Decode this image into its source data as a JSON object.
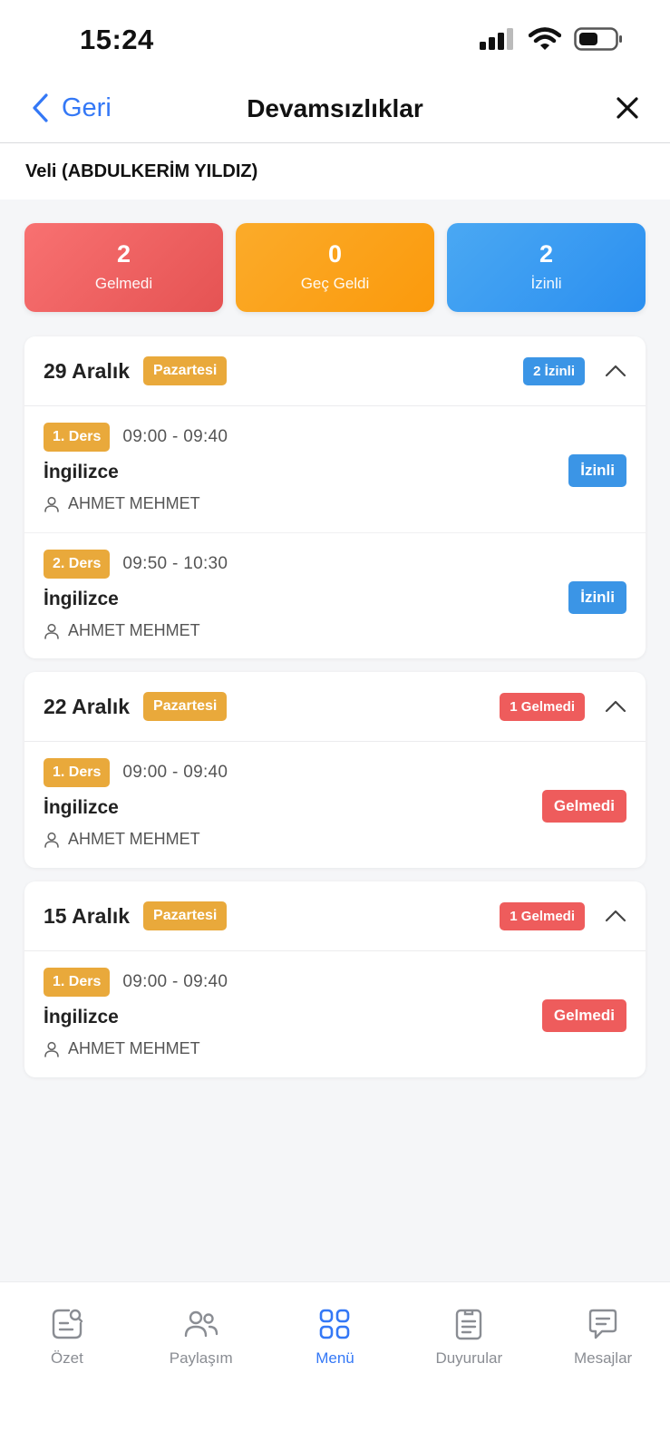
{
  "status_bar": {
    "time": "15:24"
  },
  "nav": {
    "back_label": "Geri",
    "title": "Devamsızlıklar"
  },
  "user": {
    "label": "Veli (ABDULKERİM YILDIZ)"
  },
  "summary": [
    {
      "value": "2",
      "label": "Gelmedi",
      "color": "#ee5c5c"
    },
    {
      "value": "0",
      "label": "Geç Geldi",
      "color": "#fb9a0c"
    },
    {
      "value": "2",
      "label": "İzinli",
      "color": "#2b8ff0"
    }
  ],
  "groups": [
    {
      "date": "29 Aralık",
      "day": "Pazartesi",
      "count_label": "2 İzinli",
      "lessons": [
        {
          "ders": "1. Ders",
          "time": "09:00 - 09:40",
          "subject": "İngilizce",
          "teacher": "AHMET MEHMET",
          "status": "İzinli"
        },
        {
          "ders": "2. Ders",
          "time": "09:50 - 10:30",
          "subject": "İngilizce",
          "teacher": "AHMET MEHMET",
          "status": "İzinli"
        }
      ]
    },
    {
      "date": "22 Aralık",
      "day": "Pazartesi",
      "count_label": "1 Gelmedi",
      "lessons": [
        {
          "ders": "1. Ders",
          "time": "09:00 - 09:40",
          "subject": "İngilizce",
          "teacher": "AHMET MEHMET",
          "status": "Gelmedi"
        }
      ]
    },
    {
      "date": "15 Aralık",
      "day": "Pazartesi",
      "count_label": "1 Gelmedi",
      "lessons": [
        {
          "ders": "1. Ders",
          "time": "09:00 - 09:40",
          "subject": "İngilizce",
          "teacher": "AHMET MEHMET",
          "status": "Gelmedi"
        }
      ]
    }
  ],
  "tabbar": [
    {
      "label": "Özet",
      "icon": "summary-icon"
    },
    {
      "label": "Paylaşım",
      "icon": "people-icon"
    },
    {
      "label": "Menü",
      "icon": "grid-icon"
    },
    {
      "label": "Duyurular",
      "icon": "document-icon"
    },
    {
      "label": "Mesajlar",
      "icon": "chat-icon"
    }
  ]
}
